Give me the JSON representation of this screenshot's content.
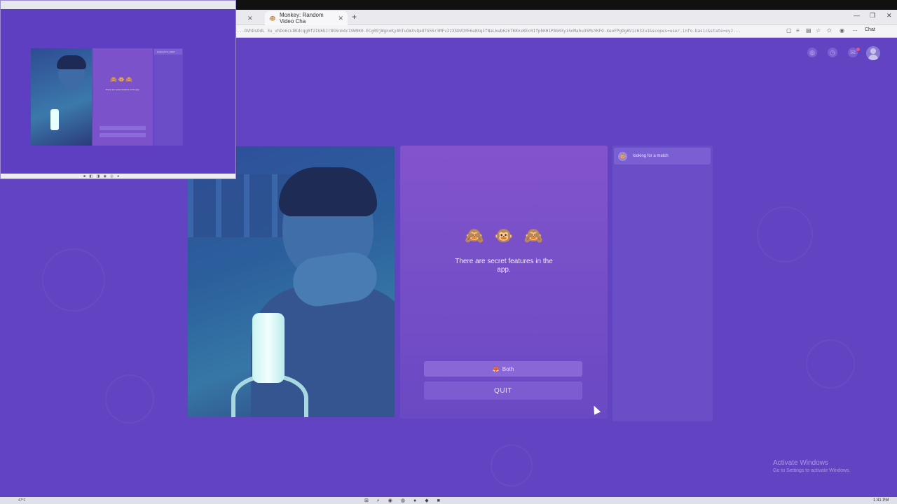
{
  "browser": {
    "tabs": [
      {
        "label": "",
        "active": false
      },
      {
        "label": "Monkey: Random Video Cha",
        "active": true
      }
    ],
    "new_tab_icon": "plus-icon",
    "url": "...DVhDsOdL 3u_vhDo6cLDKdcqg0f2IU6UJr8GSnm4c1SW9K0-ECg09jWgnoKy4hTuOmXvQaU7G5Sr3MFv2zXSDVOYE6a0XqIfNaLkwb62nTKKnxKEc01fphKH1P8G03yi5nMahu35MsYKFO-4eoFPgOgAVic632u1&scopes=user.info.basic&state=eyJ...",
    "chat_label": "Chat",
    "window_controls": [
      "—",
      "❐",
      "✕"
    ]
  },
  "app": {
    "header_icons": [
      "globe-icon",
      "history-icon",
      "chat-icon",
      "avatar"
    ],
    "tip_emojis": [
      "🙈",
      "🐵",
      "🙈"
    ],
    "tip_text": "There are secret features in the app.",
    "both_button": {
      "icon": "🦊",
      "label": "Both"
    },
    "quit_button": "QUIT",
    "match_status": "looking for a match",
    "match_avatar": "🐵"
  },
  "mini_window": {
    "tip_text": "There are secret features in the app.",
    "match_status": "looking for a match"
  },
  "watermark": {
    "line1": "Activate Windows",
    "line2": "Go to Settings to activate Windows."
  },
  "taskbar": {
    "left_text": "47°F",
    "time": "1:41 PM"
  }
}
